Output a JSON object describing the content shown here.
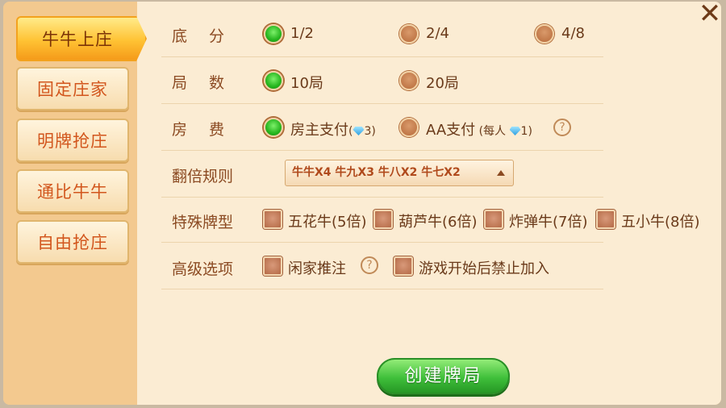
{
  "tabs": [
    {
      "label": "牛牛上庄",
      "active": true
    },
    {
      "label": "固定庄家",
      "active": false
    },
    {
      "label": "明牌抢庄",
      "active": false
    },
    {
      "label": "通比牛牛",
      "active": false
    },
    {
      "label": "自由抢庄",
      "active": false
    }
  ],
  "rows": {
    "base_score": {
      "label": "底分",
      "options": [
        {
          "label": "1/2",
          "selected": true
        },
        {
          "label": "2/4",
          "selected": false
        },
        {
          "label": "4/8",
          "selected": false
        }
      ]
    },
    "rounds": {
      "label": "局数",
      "options": [
        {
          "label": "10局",
          "selected": true
        },
        {
          "label": "20局",
          "selected": false
        }
      ]
    },
    "room_fee": {
      "label": "房费",
      "options": [
        {
          "label": "房主支付",
          "cost": "3",
          "selected": true
        },
        {
          "label": "AA支付",
          "sub": "每人",
          "cost": "1",
          "selected": false
        }
      ]
    },
    "multiplier": {
      "label": "翻倍规则",
      "value": "牛牛X4 牛九X3 牛八X2 牛七X2"
    },
    "special": {
      "label": "特殊牌型",
      "options": [
        {
          "label": "五花牛(5倍)",
          "checked": false
        },
        {
          "label": "葫芦牛(6倍)",
          "checked": false
        },
        {
          "label": "炸弹牛(7倍)",
          "checked": false
        },
        {
          "label": "五小牛(8倍)",
          "checked": false
        }
      ]
    },
    "advanced": {
      "label": "高级选项",
      "options": [
        {
          "label": "闲家推注",
          "checked": false
        },
        {
          "label": "游戏开始后禁止加入",
          "checked": false
        }
      ]
    }
  },
  "help_icon": "?",
  "close_icon": "✕",
  "create_button": "创建牌局",
  "colors": {
    "accent_green": "#2fb52a",
    "tab_active": "#ffc233",
    "label_brown": "#8b4a22"
  }
}
